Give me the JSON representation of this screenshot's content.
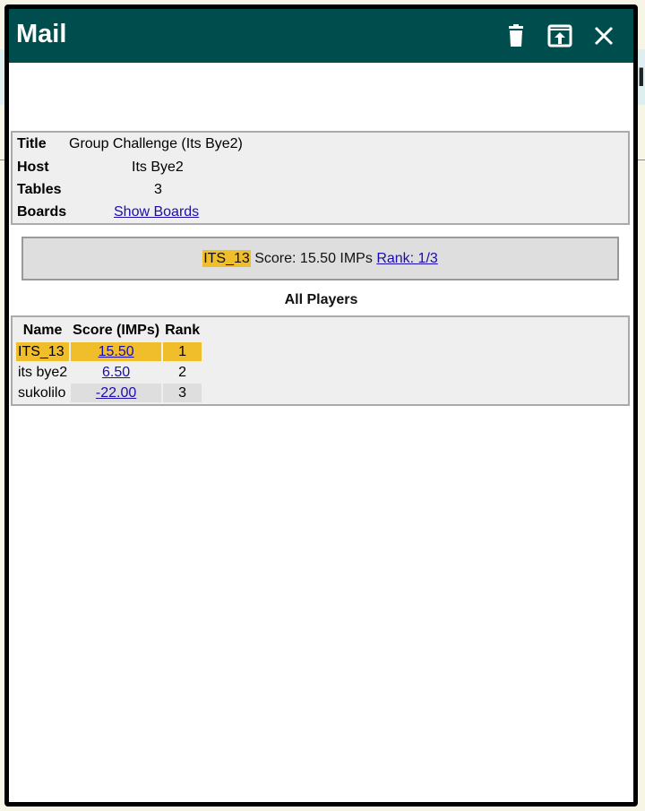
{
  "window": {
    "title": "Mail",
    "trash_icon": "trash-icon",
    "popout_icon": "popout-icon",
    "close_icon": "close-icon"
  },
  "background": {
    "edge_text": "-I"
  },
  "info": {
    "title_label": "Title",
    "title_value": "Group Challenge (Its Bye2)",
    "host_label": "Host",
    "host_value": "Its Bye2",
    "tables_label": "Tables",
    "tables_value": "3",
    "boards_label": "Boards",
    "boards_link": "Show Boards"
  },
  "score": {
    "player": "ITS_13",
    "text": "Score: 15.50 IMPs",
    "rank_link": "Rank: 1/3"
  },
  "players": {
    "heading": "All Players",
    "columns": [
      "Name",
      "Score (IMPs)",
      "Rank"
    ],
    "rows": [
      {
        "name": "ITS_13",
        "score": "15.50",
        "rank": "1"
      },
      {
        "name": "its bye2",
        "score": "6.50",
        "rank": "2"
      },
      {
        "name": "sukolilo",
        "score": "-22.00",
        "rank": "3"
      }
    ],
    "highlight_color": "#f0bd2b"
  },
  "colors": {
    "titlebar": "#004d4d",
    "link": "#1a0dab"
  }
}
